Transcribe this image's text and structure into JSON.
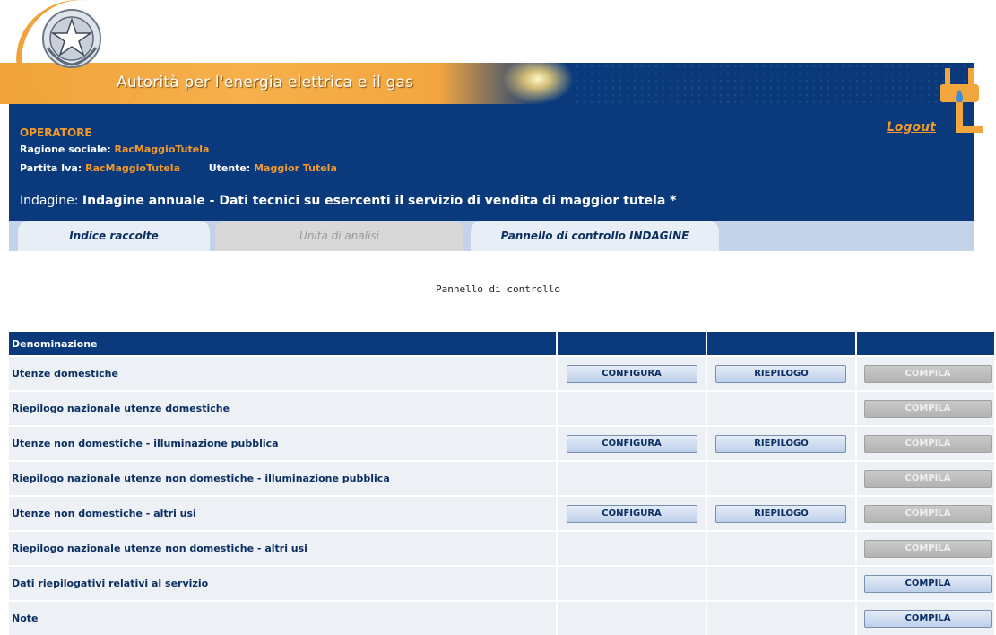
{
  "header": {
    "authority_name": "Autorità per l'energia elettrica e il gas",
    "operator_label": "OPERATORE",
    "ragione_sociale_label": "Ragione sociale:",
    "ragione_sociale_value": "RacMaggioTutela",
    "partita_iva_label": "Partita Iva:",
    "partita_iva_value": "RacMaggioTutela",
    "utente_label": "Utente:",
    "utente_value": "Maggior Tutela",
    "logout_label": "Logout",
    "indagine_label": "Indagine:",
    "indagine_value": "Indagine annuale - Dati tecnici su esercenti il servizio di vendita di maggior tutela *"
  },
  "tabs": [
    {
      "label": "Indice raccolte",
      "state": "active"
    },
    {
      "label": "Unità di analisi",
      "state": "disabled"
    },
    {
      "label": "Pannello di controllo INDAGINE",
      "state": "selected"
    }
  ],
  "panel_title": "Pannello di controllo",
  "table": {
    "header": "Denominazione",
    "buttons": {
      "configura": "CONFIGURA",
      "riepilogo": "RIEPILOGO",
      "compila": "COMPILA"
    },
    "rows": [
      {
        "name": "Utenze domestiche",
        "configura": true,
        "riepilogo": true,
        "compila_enabled": false
      },
      {
        "name": "Riepilogo nazionale utenze domestiche",
        "configura": false,
        "riepilogo": false,
        "compila_enabled": false
      },
      {
        "name": "Utenze non domestiche - illuminazione pubblica",
        "configura": true,
        "riepilogo": true,
        "compila_enabled": false
      },
      {
        "name": "Riepilogo nazionale utenze non domestiche - illuminazione pubblica",
        "configura": false,
        "riepilogo": false,
        "compila_enabled": false
      },
      {
        "name": "Utenze non domestiche - altri usi",
        "configura": true,
        "riepilogo": true,
        "compila_enabled": false
      },
      {
        "name": "Riepilogo nazionale utenze non domestiche - altri usi",
        "configura": false,
        "riepilogo": false,
        "compila_enabled": false
      },
      {
        "name": "Dati riepilogativi relativi al servizio",
        "configura": false,
        "riepilogo": false,
        "compila_enabled": true
      },
      {
        "name": "Note",
        "configura": false,
        "riepilogo": false,
        "compila_enabled": true
      }
    ]
  },
  "colors": {
    "navy": "#0b3a7c",
    "orange": "#f39a2d",
    "tab_bg": "#c4d3e9"
  }
}
